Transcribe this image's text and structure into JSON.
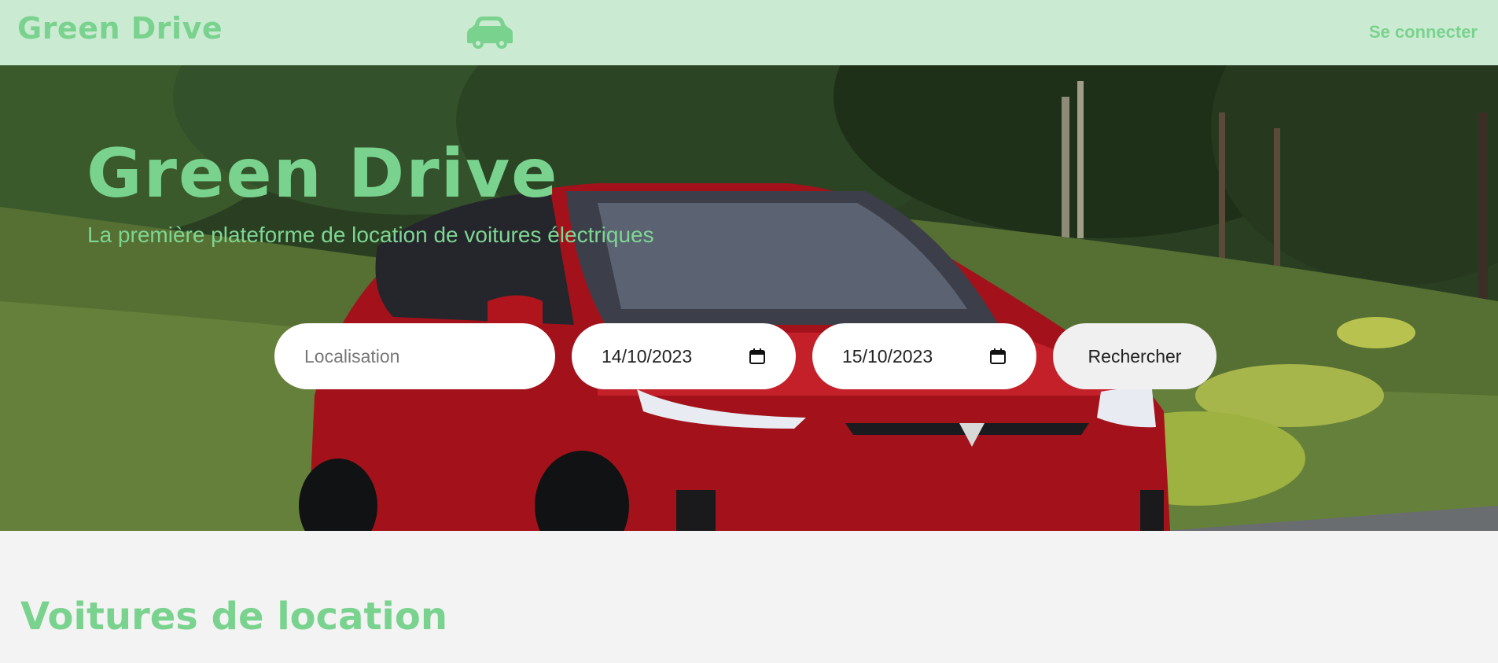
{
  "navbar": {
    "brand": "Green Drive",
    "icon": "car-icon",
    "login_label": "Se connecter"
  },
  "hero": {
    "title": "Green Drive",
    "subtitle": "La première plateforme de location de voitures électriques"
  },
  "search": {
    "location_placeholder": "Localisation",
    "start_date": "14/10/2023",
    "end_date": "15/10/2023",
    "button_label": "Rechercher"
  },
  "section": {
    "title": "Voitures de location"
  },
  "colors": {
    "accent": "#79d38e",
    "navbar_bg": "#cbead2",
    "page_bg": "#f3f3f3",
    "car_red": "#b0141c"
  }
}
